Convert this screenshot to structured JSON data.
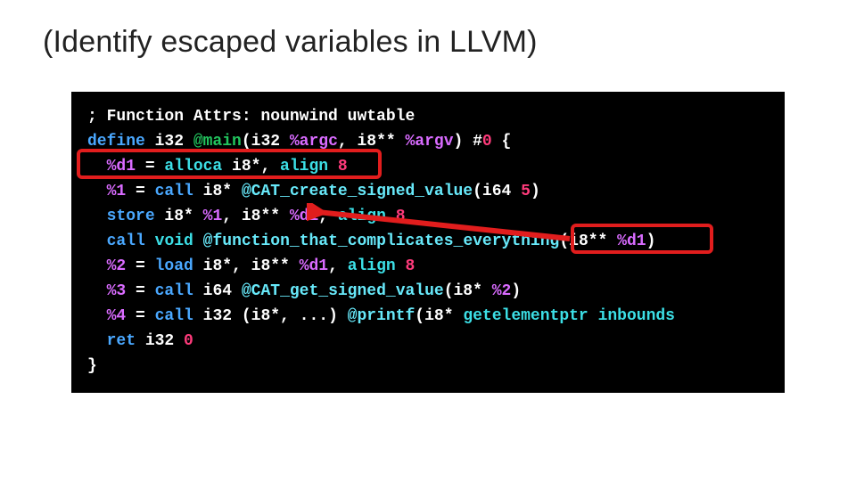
{
  "title": "(Identify escaped variables in LLVM)",
  "code": {
    "l1_a": "; Function Attrs: nounwind uwtable",
    "l2_a": "define",
    "l2_b": " i32 ",
    "l2_c": "@main",
    "l2_d": "(i32 ",
    "l2_e": "%argc",
    "l2_f": ", i8** ",
    "l2_g": "%argv",
    "l2_h": ") #",
    "l2_i": "0",
    "l2_j": " {",
    "l3_a": "  ",
    "l3_b": "%d1",
    "l3_c": " = ",
    "l3_d": "alloca",
    "l3_e": " i8*, ",
    "l3_f": "align",
    "l3_g": " ",
    "l3_h": "8",
    "l4_a": "  ",
    "l4_b": "%1",
    "l4_c": " = ",
    "l4_d": "call",
    "l4_e": " i8* ",
    "l4_f": "@CAT_create_signed_value",
    "l4_g": "(i64 ",
    "l4_h": "5",
    "l4_i": ")",
    "l5_a": "  ",
    "l5_b": "store",
    "l5_c": " i8* ",
    "l5_d": "%1",
    "l5_e": ", i8** ",
    "l5_f": "%d1",
    "l5_g": ", ",
    "l5_h": "align",
    "l5_i": " ",
    "l5_j": "8",
    "l6_a": "  ",
    "l6_b": "call",
    "l6_c": " ",
    "l6_d": "void",
    "l6_e": " ",
    "l6_f": "@function_that_complicates_everything",
    "l6_g": "(i8** ",
    "l6_h": "%d1",
    "l6_i": ")",
    "l7_a": "  ",
    "l7_b": "%2",
    "l7_c": " = ",
    "l7_d": "load",
    "l7_e": " i8*, i8** ",
    "l7_f": "%d1",
    "l7_g": ", ",
    "l7_h": "align",
    "l7_i": " ",
    "l7_j": "8",
    "l8_a": "  ",
    "l8_b": "%3",
    "l8_c": " = ",
    "l8_d": "call",
    "l8_e": " i64 ",
    "l8_f": "@CAT_get_signed_value",
    "l8_g": "(i8* ",
    "l8_h": "%2",
    "l8_i": ")",
    "l9_a": "  ",
    "l9_b": "%4",
    "l9_c": " = ",
    "l9_d": "call",
    "l9_e": " i32 (i8*, ...) ",
    "l9_f": "@printf",
    "l9_g": "(i8* ",
    "l9_h": "getelementptr",
    "l9_i": " ",
    "l9_j": "inbounds",
    "l10_a": "  ",
    "l10_b": "ret",
    "l10_c": " i32 ",
    "l10_d": "0",
    "l11_a": "}"
  },
  "annotations": {
    "highlight1_desc": "alloca-line",
    "highlight2_desc": "passed-argument",
    "arrow_desc": "arg-points-to-alloca"
  },
  "colors": {
    "highlight": "#e11d1d",
    "bg_code": "#000000"
  }
}
